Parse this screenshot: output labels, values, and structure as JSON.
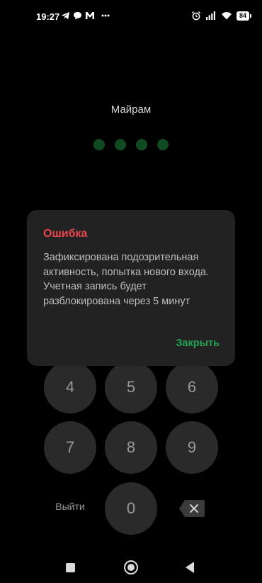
{
  "status_bar": {
    "time": "19:27",
    "battery": "84",
    "left_icons": [
      "telegram-icon",
      "chat-bubble-icon",
      "gmail-icon",
      "more-dots-icon"
    ],
    "right_icons": [
      "alarm-icon",
      "signal-icon",
      "wifi-icon",
      "battery-icon"
    ]
  },
  "lock": {
    "user_name": "Майрам",
    "pin_dots": 4,
    "keypad": [
      "4",
      "5",
      "6",
      "7",
      "8",
      "9",
      "0"
    ],
    "exit_label": "Выйти",
    "dot_color": "#0f4a21"
  },
  "dialog": {
    "title": "Ошибка",
    "message": "Зафиксирована подозрительная активность, попытка нового входа. Учетная запись будет разблокирована через 5 минут",
    "close_label": "Закрыть",
    "title_color": "#e5474c",
    "action_color": "#23a352"
  },
  "nav_bar": {
    "icons": [
      "recent-apps-icon",
      "home-icon",
      "back-icon"
    ]
  }
}
